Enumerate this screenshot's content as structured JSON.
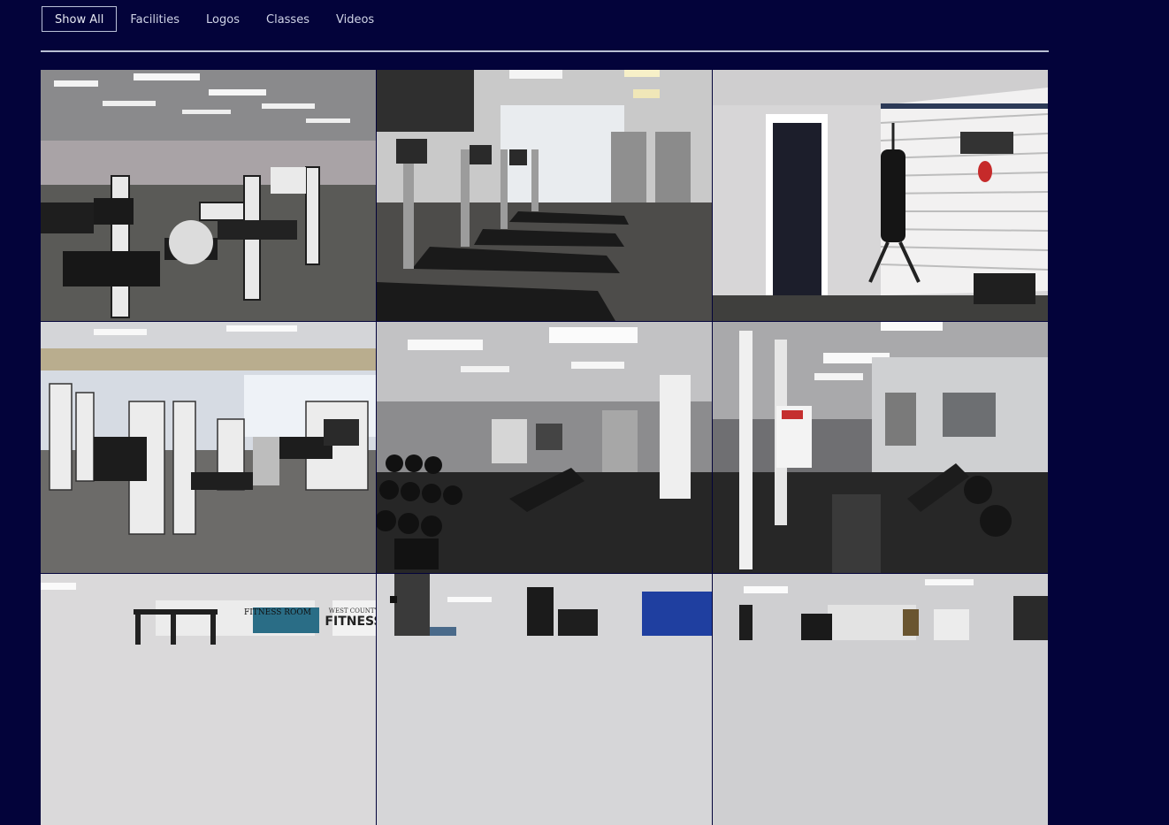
{
  "filters": [
    {
      "label": "Show All",
      "active": true
    },
    {
      "label": "Facilities",
      "active": false
    },
    {
      "label": "Logos",
      "active": false
    },
    {
      "label": "Classes",
      "active": false
    },
    {
      "label": "Videos",
      "active": false
    }
  ],
  "gallery": {
    "tiles": [
      {
        "scene": "gym-machines-carpet"
      },
      {
        "scene": "treadmills-row"
      },
      {
        "scene": "punching-bag-room"
      },
      {
        "scene": "gym-floor-overview"
      },
      {
        "scene": "dumbbell-rack-room"
      },
      {
        "scene": "squat-rack-room"
      },
      {
        "scene": "power-rack-fitness-room"
      },
      {
        "scene": "cable-machine-room"
      },
      {
        "scene": "weight-machines-room"
      }
    ],
    "signs": {
      "fitness_room": "FITNESS ROOM",
      "west_county": "WEST COUNTY",
      "fitness": "FITNESS"
    }
  }
}
